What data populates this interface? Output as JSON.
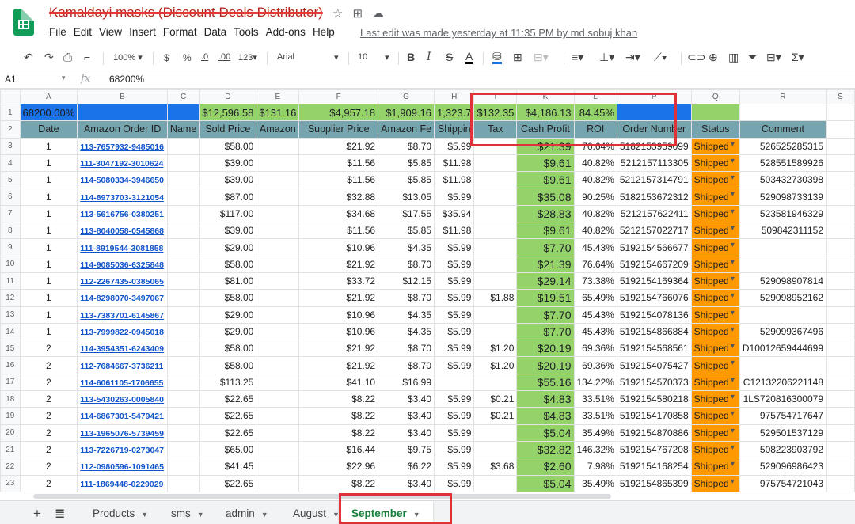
{
  "doc": {
    "title": "Kamaldayi masks (Discount Deals Distributor)",
    "menus": [
      "File",
      "Edit",
      "View",
      "Insert",
      "Format",
      "Data",
      "Tools",
      "Add-ons",
      "Help"
    ],
    "last_edit": "Last edit was made yesterday at 11:35 PM by md sobuj khan"
  },
  "toolbar": {
    "zoom": "100%",
    "currency": "$",
    "percent": "%",
    "dec_less": ".0",
    "dec_more": ".00",
    "more_formats": "123",
    "font": "Arial",
    "font_size": "10",
    "bold": "B",
    "italic": "I",
    "strike": "S",
    "text_color": "A"
  },
  "formula_bar": {
    "cell_ref": "A1",
    "fx": "fx",
    "value": "68200%"
  },
  "columns": [
    "A",
    "B",
    "C",
    "D",
    "E",
    "F",
    "G",
    "H",
    "I",
    "K",
    "L",
    "P",
    "Q",
    "R",
    "S"
  ],
  "summary_row": {
    "num": "1",
    "a": "68200.00%",
    "d": "$12,596.58",
    "e": "$131.16",
    "f": "$4,957.18",
    "g": "$1,909.16",
    "h": "1,323.7",
    "i": "$132.35",
    "k": "$4,186.13",
    "l": "84.45%"
  },
  "header_row": {
    "num": "2",
    "cells": [
      "Date",
      "Amazon Order ID",
      "Name",
      "Sold Price",
      "Amazon",
      "Supplier Price",
      "Amazon Fe",
      "Shippin",
      "Tax",
      "Cash Profit",
      "ROI",
      "Order Number",
      "Status",
      "Comment",
      ""
    ]
  },
  "rows": [
    {
      "n": "3",
      "date": "1",
      "order": "113-7657932-9485016",
      "sold": "$58.00",
      "supplier": "$21.92",
      "fee": "$8.70",
      "ship": "$5.99",
      "tax": "",
      "profit": "$21.39",
      "roi": "76.64%",
      "ordernum": "5182153959099",
      "status": "Shipped",
      "comment": "526525285315"
    },
    {
      "n": "4",
      "date": "1",
      "order": "111-3047192-3010624",
      "sold": "$39.00",
      "supplier": "$11.56",
      "fee": "$5.85",
      "ship": "$11.98",
      "tax": "",
      "profit": "$9.61",
      "roi": "40.82%",
      "ordernum": "5212157113305",
      "status": "Shipped",
      "comment": "528551589926"
    },
    {
      "n": "5",
      "date": "1",
      "order": "114-5080334-3946650",
      "sold": "$39.00",
      "supplier": "$11.56",
      "fee": "$5.85",
      "ship": "$11.98",
      "tax": "",
      "profit": "$9.61",
      "roi": "40.82%",
      "ordernum": "5212157314791",
      "status": "Shipped",
      "comment": "503432730398"
    },
    {
      "n": "6",
      "date": "1",
      "order": "114-8973703-3121054",
      "sold": "$87.00",
      "supplier": "$32.88",
      "fee": "$13.05",
      "ship": "$5.99",
      "tax": "",
      "profit": "$35.08",
      "roi": "90.25%",
      "ordernum": "5182153672312",
      "status": "Shipped",
      "comment": "529098733139"
    },
    {
      "n": "7",
      "date": "1",
      "order": "113-5616756-0380251",
      "sold": "$117.00",
      "supplier": "$34.68",
      "fee": "$17.55",
      "ship": "$35.94",
      "tax": "",
      "profit": "$28.83",
      "roi": "40.82%",
      "ordernum": "5212157622411",
      "status": "Shipped",
      "comment": "523581946329"
    },
    {
      "n": "8",
      "date": "1",
      "order": "113-8040058-0545868",
      "sold": "$39.00",
      "supplier": "$11.56",
      "fee": "$5.85",
      "ship": "$11.98",
      "tax": "",
      "profit": "$9.61",
      "roi": "40.82%",
      "ordernum": "5212157022717",
      "status": "Shipped",
      "comment": "509842311152"
    },
    {
      "n": "9",
      "date": "1",
      "order": "111-8919544-3081858",
      "sold": "$29.00",
      "supplier": "$10.96",
      "fee": "$4.35",
      "ship": "$5.99",
      "tax": "",
      "profit": "$7.70",
      "roi": "45.43%",
      "ordernum": "5192154566677",
      "status": "Shipped",
      "comment": ""
    },
    {
      "n": "10",
      "date": "1",
      "order": "114-9085036-6325848",
      "sold": "$58.00",
      "supplier": "$21.92",
      "fee": "$8.70",
      "ship": "$5.99",
      "tax": "",
      "profit": "$21.39",
      "roi": "76.64%",
      "ordernum": "5192154667209",
      "status": "Shipped",
      "comment": ""
    },
    {
      "n": "11",
      "date": "1",
      "order": "112-2267435-0385065",
      "sold": "$81.00",
      "supplier": "$33.72",
      "fee": "$12.15",
      "ship": "$5.99",
      "tax": "",
      "profit": "$29.14",
      "roi": "73.38%",
      "ordernum": "5192154169364",
      "status": "Shipped",
      "comment": "529098907814"
    },
    {
      "n": "12",
      "date": "1",
      "order": "114-8298070-3497067",
      "sold": "$58.00",
      "supplier": "$21.92",
      "fee": "$8.70",
      "ship": "$5.99",
      "tax": "$1.88",
      "profit": "$19.51",
      "roi": "65.49%",
      "ordernum": "5192154766076",
      "status": "Shipped",
      "comment": "529098952162"
    },
    {
      "n": "13",
      "date": "1",
      "order": "113-7383701-6145867",
      "sold": "$29.00",
      "supplier": "$10.96",
      "fee": "$4.35",
      "ship": "$5.99",
      "tax": "",
      "profit": "$7.70",
      "roi": "45.43%",
      "ordernum": "5192154078136",
      "status": "Shipped",
      "comment": ""
    },
    {
      "n": "14",
      "date": "1",
      "order": "113-7999822-0945018",
      "sold": "$29.00",
      "supplier": "$10.96",
      "fee": "$4.35",
      "ship": "$5.99",
      "tax": "",
      "profit": "$7.70",
      "roi": "45.43%",
      "ordernum": "5192154866884",
      "status": "Shipped",
      "comment": "529099367496"
    },
    {
      "n": "15",
      "date": "2",
      "order": "114-3954351-6243409",
      "sold": "$58.00",
      "supplier": "$21.92",
      "fee": "$8.70",
      "ship": "$5.99",
      "tax": "$1.20",
      "profit": "$20.19",
      "roi": "69.36%",
      "ordernum": "5192154568561",
      "status": "Shipped",
      "comment": "D10012659444699"
    },
    {
      "n": "16",
      "date": "2",
      "order": "112-7684667-3736211",
      "sold": "$58.00",
      "supplier": "$21.92",
      "fee": "$8.70",
      "ship": "$5.99",
      "tax": "$1.20",
      "profit": "$20.19",
      "roi": "69.36%",
      "ordernum": "5192154075427",
      "status": "Shipped",
      "comment": ""
    },
    {
      "n": "17",
      "date": "2",
      "order": "114-6061105-1706655",
      "sold": "$113.25",
      "supplier": "$41.10",
      "fee": "$16.99",
      "ship": "",
      "tax": "",
      "profit": "$55.16",
      "roi": "134.22%",
      "ordernum": "5192154570373",
      "status": "Shipped",
      "comment": "C12132206221148"
    },
    {
      "n": "18",
      "date": "2",
      "order": "113-5430263-0005840",
      "sold": "$22.65",
      "supplier": "$8.22",
      "fee": "$3.40",
      "ship": "$5.99",
      "tax": "$0.21",
      "profit": "$4.83",
      "roi": "33.51%",
      "ordernum": "5192154580218",
      "status": "Shipped",
      "comment": "1LS720816300079"
    },
    {
      "n": "19",
      "date": "2",
      "order": "114-6867301-5479421",
      "sold": "$22.65",
      "supplier": "$8.22",
      "fee": "$3.40",
      "ship": "$5.99",
      "tax": "$0.21",
      "profit": "$4.83",
      "roi": "33.51%",
      "ordernum": "5192154170858",
      "status": "Shipped",
      "comment": "975754717647"
    },
    {
      "n": "20",
      "date": "2",
      "order": "113-1965076-5739459",
      "sold": "$22.65",
      "supplier": "$8.22",
      "fee": "$3.40",
      "ship": "$5.99",
      "tax": "",
      "profit": "$5.04",
      "roi": "35.49%",
      "ordernum": "5192154870886",
      "status": "Shipped",
      "comment": "529501537129"
    },
    {
      "n": "21",
      "date": "2",
      "order": "113-7226719-0273047",
      "sold": "$65.00",
      "supplier": "$16.44",
      "fee": "$9.75",
      "ship": "$5.99",
      "tax": "",
      "profit": "$32.82",
      "roi": "146.32%",
      "ordernum": "5192154767208",
      "status": "Shipped",
      "comment": "508223903792"
    },
    {
      "n": "22",
      "date": "2",
      "order": "112-0980596-1091465",
      "sold": "$41.45",
      "supplier": "$22.96",
      "fee": "$6.22",
      "ship": "$5.99",
      "tax": "$3.68",
      "profit": "$2.60",
      "roi": "7.98%",
      "ordernum": "5192154168254",
      "status": "Shipped",
      "comment": "529096986423"
    },
    {
      "n": "23",
      "date": "2",
      "order": "111-1869448-0229029",
      "sold": "$22.65",
      "supplier": "$8.22",
      "fee": "$3.40",
      "ship": "$5.99",
      "tax": "",
      "profit": "$5.04",
      "roi": "35.49%",
      "ordernum": "5192154865399",
      "status": "Shipped",
      "comment": "975754721043"
    }
  ],
  "sheet_tabs": [
    {
      "label": "Products"
    },
    {
      "label": "sms"
    },
    {
      "label": "admin"
    },
    {
      "label": "August"
    },
    {
      "label": "September",
      "active": true
    }
  ],
  "colors": {
    "green": "#93d36a",
    "header": "#76a5af",
    "status": "#ff9900",
    "blue": "#1a73e8",
    "annotation": "#e0303a"
  }
}
